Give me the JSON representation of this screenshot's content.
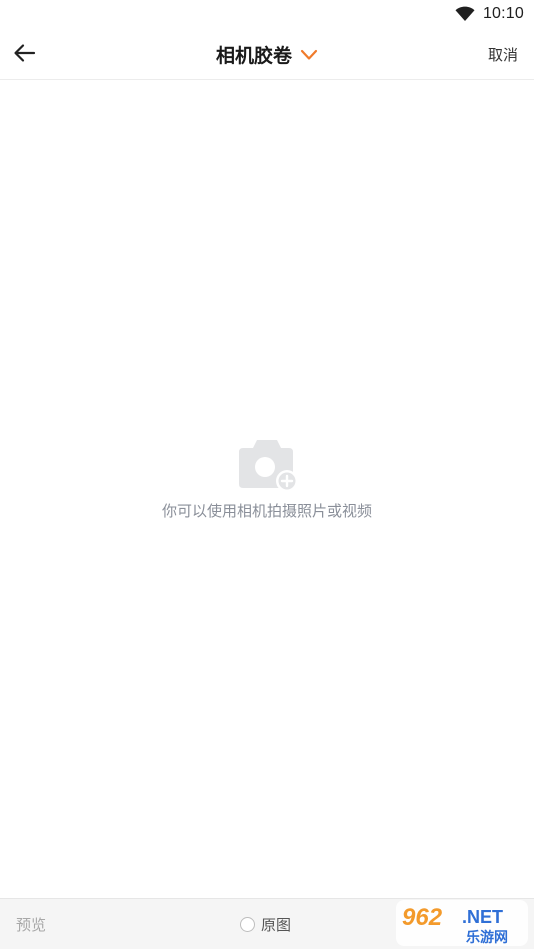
{
  "status_bar": {
    "time": "10:10",
    "wifi_icon": "wifi-icon"
  },
  "nav": {
    "back_icon": "arrow-left-icon",
    "title": "相机胶卷",
    "dropdown_icon": "chevron-down-icon",
    "cancel_label": "取消",
    "accent_color": "#f07b2b"
  },
  "empty_state": {
    "icon": "camera-add-icon",
    "message": "你可以使用相机拍摄照片或视频"
  },
  "bottom_bar": {
    "preview_label": "预览",
    "original_label": "原图",
    "original_checked": false
  },
  "watermark": {
    "text_top": "962.NET",
    "text_bottom": "乐游网"
  }
}
